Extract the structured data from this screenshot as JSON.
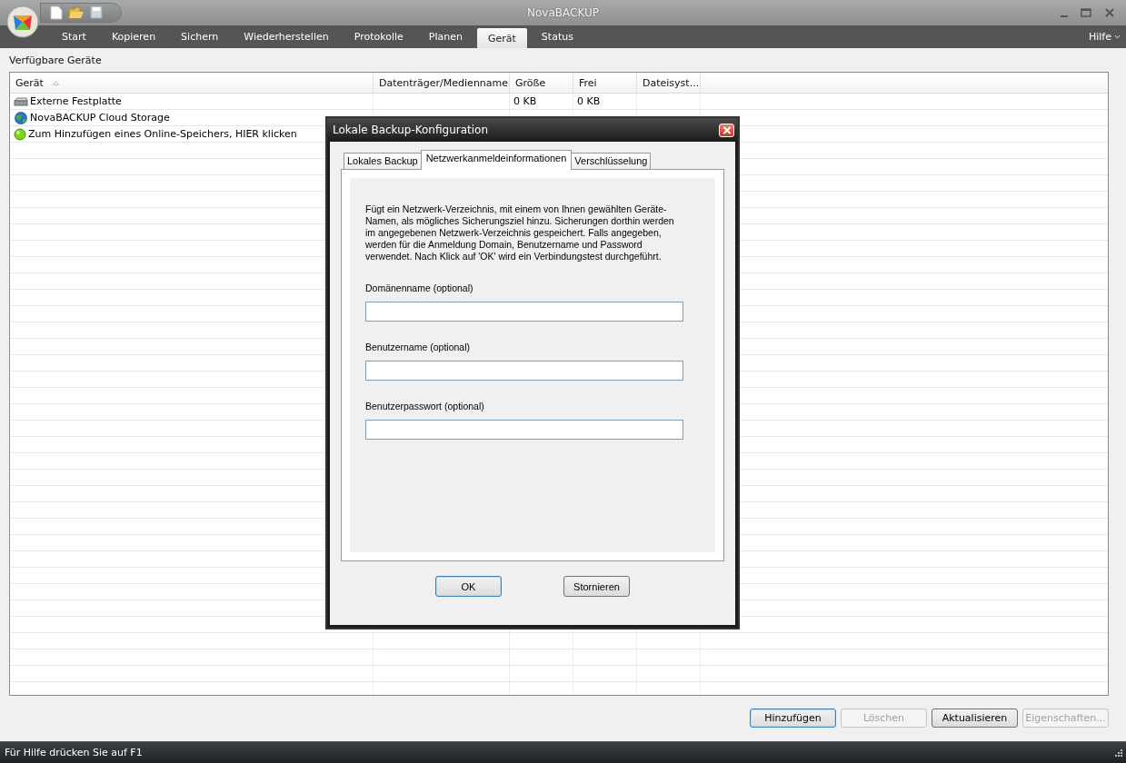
{
  "window": {
    "title": "NovaBACKUP"
  },
  "menu": [
    {
      "label": "Start",
      "selected": false
    },
    {
      "label": "Kopieren",
      "selected": false
    },
    {
      "label": "Sichern",
      "selected": false
    },
    {
      "label": "Wiederherstellen",
      "selected": false
    },
    {
      "label": "Protokolle",
      "selected": false
    },
    {
      "label": "Planen",
      "selected": false
    },
    {
      "label": "Gerät",
      "selected": true
    },
    {
      "label": "Status",
      "selected": false
    }
  ],
  "help_menu": "Hilfe",
  "section_title": "Verfügbare Geräte",
  "table": {
    "columns": [
      "Gerät",
      "Datenträger/Medienname",
      "Größe",
      "Frei",
      "Dateisyst..."
    ],
    "rows": [
      {
        "kind": "disk",
        "cells": [
          "Externe Festplatte",
          "",
          "0 KB",
          "0 KB",
          ""
        ]
      },
      {
        "kind": "cloud",
        "cells": [
          "NovaBACKUP Cloud Storage",
          "",
          "",
          "",
          ""
        ]
      },
      {
        "kind": "add",
        "cells": [
          "Zum Hinzufügen eines Online-Speichers, HIER klicken",
          "",
          "",
          "",
          ""
        ]
      }
    ]
  },
  "buttons": [
    {
      "label": "Hinzufügen",
      "default": true,
      "disabled": false
    },
    {
      "label": "Löschen",
      "default": false,
      "disabled": true
    },
    {
      "label": "Aktualisieren",
      "default": false,
      "disabled": false
    },
    {
      "label": "Eigenschaften...",
      "default": false,
      "disabled": true
    }
  ],
  "status_bar": "Für Hilfe drücken Sie auf F1",
  "dialog": {
    "title": "Lokale Backup-Konfiguration",
    "tabs": [
      {
        "label": "Lokales Backup",
        "selected": false
      },
      {
        "label": "Netzwerkanmeldeinformationen",
        "selected": true
      },
      {
        "label": "Verschlüsselung",
        "selected": false
      }
    ],
    "description": "Fügt ein Netzwerk-Verzeichnis, mit einem von Ihnen gewählten Geräte-Namen, als mögliches Sicherungsziel hinzu. Sicherungen dorthin werden im angegebenen Netzwerk-Verzeichnis gespeichert. Falls angegeben, werden für die Anmeldung Domain, Benutzername und Password verwendet. Nach Klick auf 'OK' wird ein Verbindungstest durchgeführt.",
    "fields": [
      {
        "label": "Domänenname (optional)"
      },
      {
        "label": "Benutzername (optional)"
      },
      {
        "label": "Benutzerpasswort (optional)"
      }
    ],
    "buttons": [
      {
        "label": "OK",
        "default": true
      },
      {
        "label": "Stornieren",
        "default": false
      }
    ]
  }
}
